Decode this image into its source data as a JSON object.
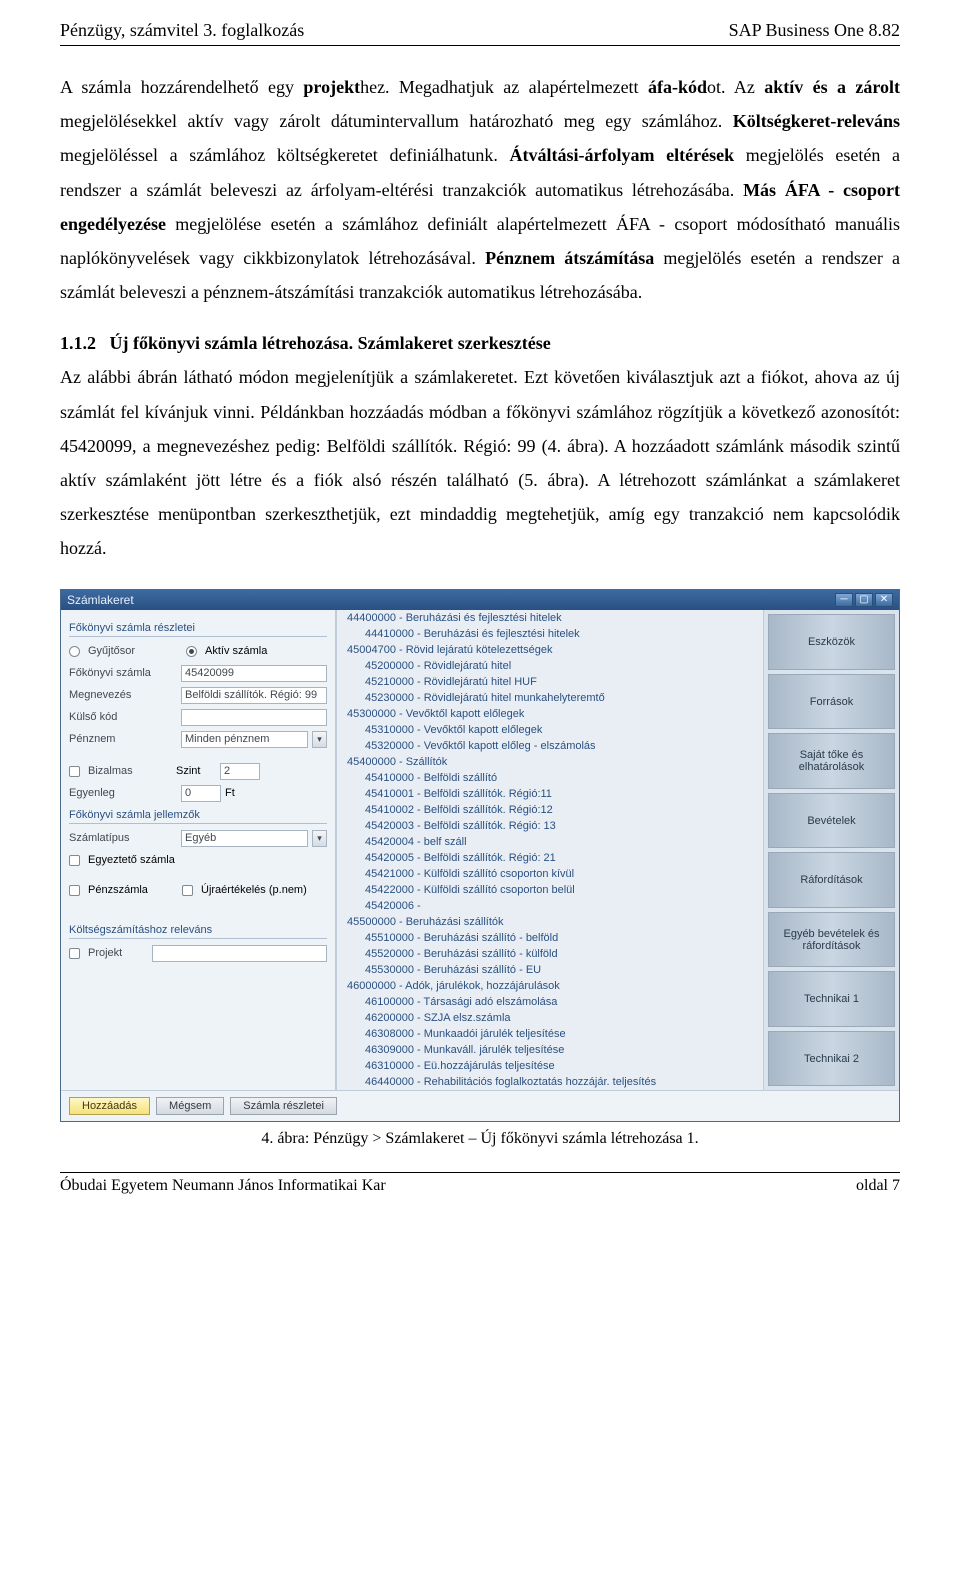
{
  "header": {
    "left": "Pénzügy, számvitel  3. foglalkozás",
    "right": "SAP Business One 8.82"
  },
  "para1": {
    "t1": "A számla hozzárendelhető egy ",
    "b1": "projekt",
    "t2": "hez. Megadhatjuk az alapértelmezett ",
    "b2": "áfa-kód",
    "t3": "ot. Az ",
    "b3": "aktív és a zárolt",
    "t4": " megjelölésekkel aktív vagy zárolt dátumintervallum határozható meg egy számlához. ",
    "b4": "Költségkeret-releváns",
    "t5": " megjelöléssel a számlához költségkeretet definiálhatunk. ",
    "b5": "Átváltási-árfolyam eltérések",
    "t6": " megjelölés esetén a rendszer a számlát beleveszi az árfolyam-eltérési tranzakciók automatikus létrehozásába. ",
    "b6": "Más ÁFA - csoport engedélyezése",
    "t7": " megjelölése esetén a számlához definiált alapértelmezett ÁFA - csoport módosítható manuális naplókönyvelések vagy cikkbizonylatok létrehozásával. ",
    "b7": "Pénznem átszámítása",
    "t8": " megjelölés esetén a rendszer a számlát beleveszi a pénznem-átszámítási tranzakciók automatikus létrehozásába."
  },
  "heading": {
    "num": "1.1.2",
    "text": "Új főkönyvi számla létrehozása. Számlakeret szerkesztése"
  },
  "para2": "Az alábbi ábrán látható módon megjelenítjük a számlakeretet. Ezt követően kiválasztjuk azt a fiókot, ahova az új számlát fel kívánjuk vinni. Példánkban hozzáadás módban a főkönyvi számlához rögzítjük a következő azonosítót: 45420099, a megnevezéshez pedig: Belföldi szállítók. Régió: 99 (4. ábra). A hozzáadott számlánk második szintű aktív számlaként jött létre és a fiók alsó részén található (5. ábra). A létrehozott számlánkat a számlakeret szerkesztése menüpontban szerkeszthetjük, ezt mindaddig megtehetjük, amíg egy tranzakció nem kapcsolódik hozzá.",
  "caption": "4. ábra: Pénzügy > Számlakeret – Új főkönyvi számla létrehozása 1.",
  "footer": {
    "left": "Óbudai Egyetem Neumann János Informatikai Kar",
    "right": "oldal 7"
  },
  "sap": {
    "title": "Számlakeret",
    "left": {
      "section1": "Főkönyvi számla részletei",
      "radio1": "Gyűjtősor",
      "radio2": "Aktív számla",
      "l_fokonyvi": "Főkönyvi számla",
      "v_fokonyvi": "45420099",
      "l_megnev": "Megnevezés",
      "v_megnev": "Belföldi szállítók. Régió: 99",
      "l_kulso": "Külső kód",
      "l_penznem": "Pénznem",
      "v_penznem": "Minden pénznem",
      "l_bizalmas": "Bizalmas",
      "l_szint": "Szint",
      "v_szint": "2",
      "l_egyenleg": "Egyenleg",
      "v_egyenleg": "0",
      "v_ft": "Ft",
      "section2": "Főkönyvi számla jellemzők",
      "l_szlatipus": "Számlatípus",
      "v_szlatipus": "Egyéb",
      "l_egyezt": "Egyeztető számla",
      "l_penzszla": "Pénzszámla",
      "l_ujraert": "Újraértékelés (p.nem)",
      "section3": "Költségszámításhoz releváns",
      "l_projekt": "Projekt"
    },
    "tree": [
      {
        "l": 1,
        "t": "44400000 - Beruházási és fejlesztési hitelek"
      },
      {
        "l": 2,
        "t": "44410000 - Beruházási és fejlesztési hitelek"
      },
      {
        "l": 1,
        "t": "45004700 - Rövid lejáratú kötelezettségek"
      },
      {
        "l": 2,
        "t": "45200000 - Rövidlejáratú hitel"
      },
      {
        "l": 2,
        "t": "45210000 - Rövidlejáratú hitel HUF"
      },
      {
        "l": 2,
        "t": "45230000 - Rövidlejáratú hitel munkahelyteremtő"
      },
      {
        "l": 1,
        "t": "45300000 - Vevőktől kapott előlegek"
      },
      {
        "l": 2,
        "t": "45310000 - Vevőktől kapott előlegek"
      },
      {
        "l": 2,
        "t": "45320000 - Vevőktől kapott előleg - elszámolás"
      },
      {
        "l": 1,
        "t": "45400000 - Szállítók"
      },
      {
        "l": 2,
        "t": "45410000 - Belföldi szállító"
      },
      {
        "l": 2,
        "t": "45410001 - Belföldi szállítók. Régió:11"
      },
      {
        "l": 2,
        "t": "45410002 - Belföldi szállítók. Régió:12"
      },
      {
        "l": 2,
        "t": "45420003 - Belföldi szállítók. Régió: 13"
      },
      {
        "l": 2,
        "t": "45420004 - belf száll"
      },
      {
        "l": 2,
        "t": "45420005 - Belföldi szállítók. Régió: 21"
      },
      {
        "l": 2,
        "t": "45421000 - Külföldi szállító csoporton kívül"
      },
      {
        "l": 2,
        "t": "45422000 - Külföldi szállító csoporton belül"
      },
      {
        "l": 2,
        "t": "45420006 -"
      },
      {
        "l": 1,
        "t": "45500000 - Beruházási szállítók"
      },
      {
        "l": 2,
        "t": "45510000 - Beruházási szállító - belföld"
      },
      {
        "l": 2,
        "t": "45520000 - Beruházási szállító - külföld"
      },
      {
        "l": 2,
        "t": "45530000 - Beruházási szállító - EU"
      },
      {
        "l": 1,
        "t": "46000000 - Adók, járulékok, hozzájárulások"
      },
      {
        "l": 2,
        "t": "46100000 - Társasági adó elszámolása"
      },
      {
        "l": 2,
        "t": "46200000 - SZJA elsz.számla"
      },
      {
        "l": 2,
        "t": "46308000 - Munkaadói járulék teljesítése"
      },
      {
        "l": 2,
        "t": "46309000 - Munkaváll. járulék teljesítése"
      },
      {
        "l": 2,
        "t": "46310000 - Eü.hozzájárulás teljesítése"
      },
      {
        "l": 2,
        "t": "46440000 - Rehabilitációs foglalkoztatás hozzájár. teljesítés"
      }
    ],
    "right": [
      "Eszközök",
      "Források",
      "Saját tőke és elhatárolások",
      "Bevételek",
      "Ráfordítások",
      "Egyéb bevételek és ráfordítások",
      "Technikai 1",
      "Technikai 2"
    ],
    "footer": {
      "add": "Hozzáadás",
      "cancel": "Mégsem",
      "details": "Számla részletei"
    }
  }
}
